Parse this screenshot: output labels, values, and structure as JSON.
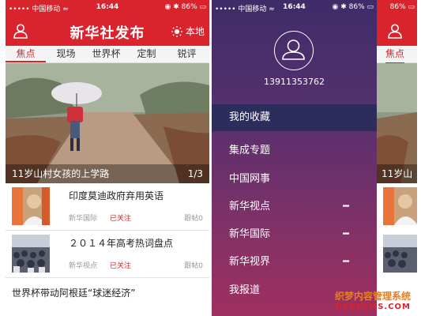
{
  "left": {
    "status": {
      "carrier": "•••••  中国移动 ≈",
      "time": "16:44",
      "battery": "◉ ✱ 86% ▭"
    },
    "nav": {
      "title": "新华社发布",
      "local": "本地"
    },
    "tabs": [
      "焦点",
      "现场",
      "世界杯",
      "定制",
      "锐评"
    ],
    "hero": {
      "caption": "11岁山村女孩的上学路",
      "index": "1/3"
    },
    "news": [
      {
        "title": "印度莫迪政府弃用英语",
        "source": "新华国际",
        "status": "已关注",
        "reply": "跟帖0"
      },
      {
        "title": "２０１４年高考热词盘点",
        "source": "新华视点",
        "status": "已关注",
        "reply": "跟帖0"
      }
    ],
    "last_title": "世界杯带动阿根廷“球迷经济”"
  },
  "right": {
    "status": {
      "carrier": "•••••  中国移动 ≈",
      "time": "16:44",
      "battery": "◉ ✱ 86% ▭"
    },
    "peek_status": "86% ▭",
    "phone": "13911353762",
    "favorites": "我的收藏",
    "items": [
      {
        "label": "集成专题",
        "dash": ""
      },
      {
        "label": "中国网事",
        "dash": ""
      },
      {
        "label": "新华视点",
        "dash": "━"
      },
      {
        "label": "新华国际",
        "dash": "━"
      },
      {
        "label": "新华视界",
        "dash": "━"
      },
      {
        "label": "我报道",
        "dash": ""
      }
    ],
    "peek_tab": "焦点",
    "peek_caption": "11岁山",
    "watermark": {
      "line1": "织梦内容管理系统",
      "line2": "DEDECMS.COM"
    }
  }
}
